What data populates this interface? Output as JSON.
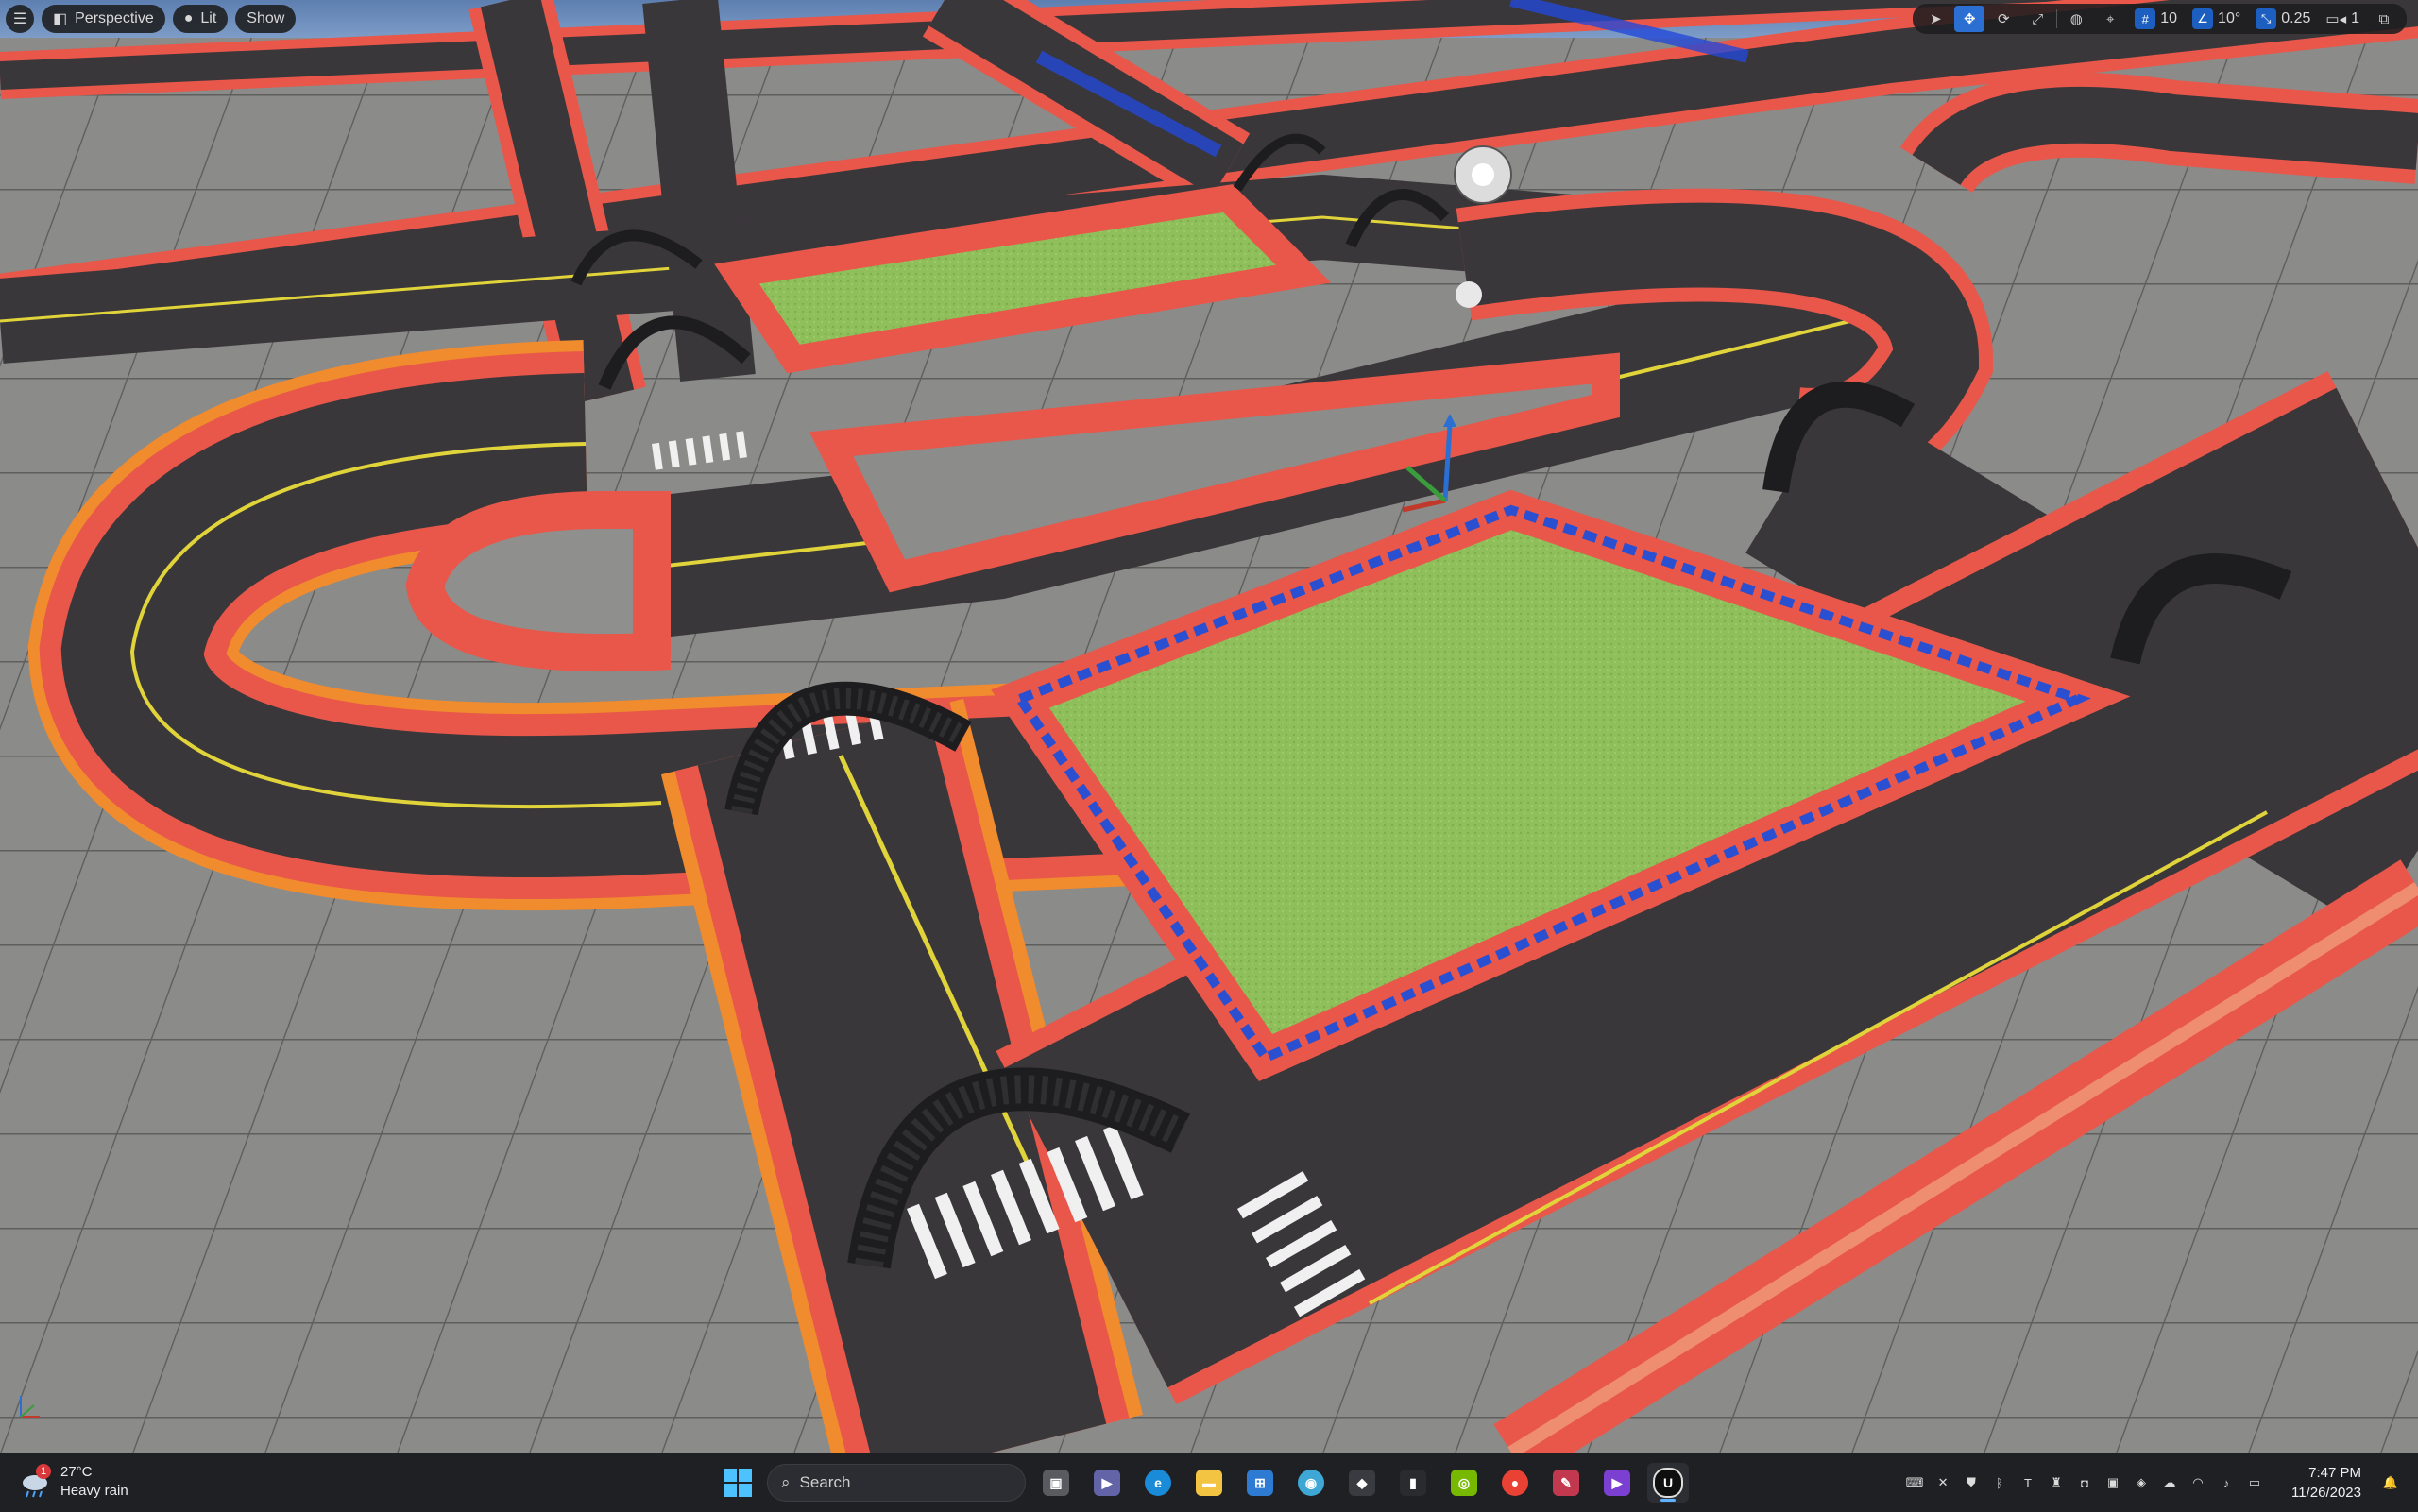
{
  "viewport_toolbar": {
    "menu_icon": "hamburger-icon",
    "perspective_label": "Perspective",
    "lit_label": "Lit",
    "show_label": "Show",
    "grid_snap_value": "10",
    "rotation_snap_value": "10°",
    "scale_snap_value": "0.25",
    "camera_speed_value": "1"
  },
  "colors": {
    "road": "#3a373b",
    "sidewalk_red": "#e8574a",
    "sidewalk_orange": "#f08b2e",
    "grass": "#8fbf5a",
    "floor": "#8c8c8a",
    "sky": "#6f93c5",
    "accent": "#2a6fd1"
  },
  "taskbar": {
    "weather": {
      "temperature": "27°C",
      "condition": "Heavy rain",
      "badge": "1"
    },
    "search_placeholder": "Search",
    "apps": [
      "task-view-icon",
      "teams-icon",
      "edge-icon",
      "file-explorer-icon",
      "store-icon",
      "browser-icon",
      "alien-icon",
      "app-icon",
      "nvidia-icon",
      "chrome-icon",
      "notes-icon",
      "video-editor-icon",
      "unreal-engine-icon"
    ],
    "clock": {
      "time": "7:47 PM",
      "date": "11/26/2023"
    }
  }
}
